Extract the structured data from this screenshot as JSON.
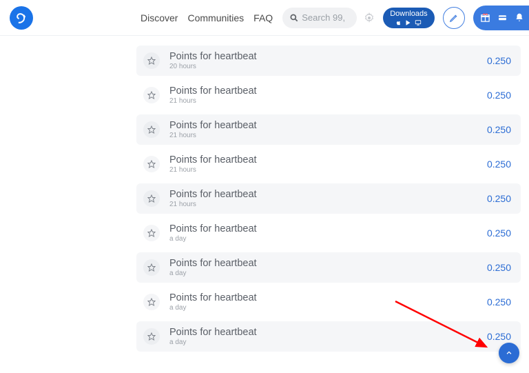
{
  "nav": {
    "discover": "Discover",
    "communities": "Communities",
    "faq": "FAQ"
  },
  "search": {
    "placeholder": "Search 99,"
  },
  "downloads": {
    "label": "Downloads"
  },
  "rows": [
    {
      "title": "Points for heartbeat",
      "time": "20 hours",
      "points": "0.250"
    },
    {
      "title": "Points for heartbeat",
      "time": "21 hours",
      "points": "0.250"
    },
    {
      "title": "Points for heartbeat",
      "time": "21 hours",
      "points": "0.250"
    },
    {
      "title": "Points for heartbeat",
      "time": "21 hours",
      "points": "0.250"
    },
    {
      "title": "Points for heartbeat",
      "time": "21 hours",
      "points": "0.250"
    },
    {
      "title": "Points for heartbeat",
      "time": "a day",
      "points": "0.250"
    },
    {
      "title": "Points for heartbeat",
      "time": "a day",
      "points": "0.250"
    },
    {
      "title": "Points for heartbeat",
      "time": "a day",
      "points": "0.250"
    },
    {
      "title": "Points for heartbeat",
      "time": "a day",
      "points": "0.250"
    }
  ]
}
